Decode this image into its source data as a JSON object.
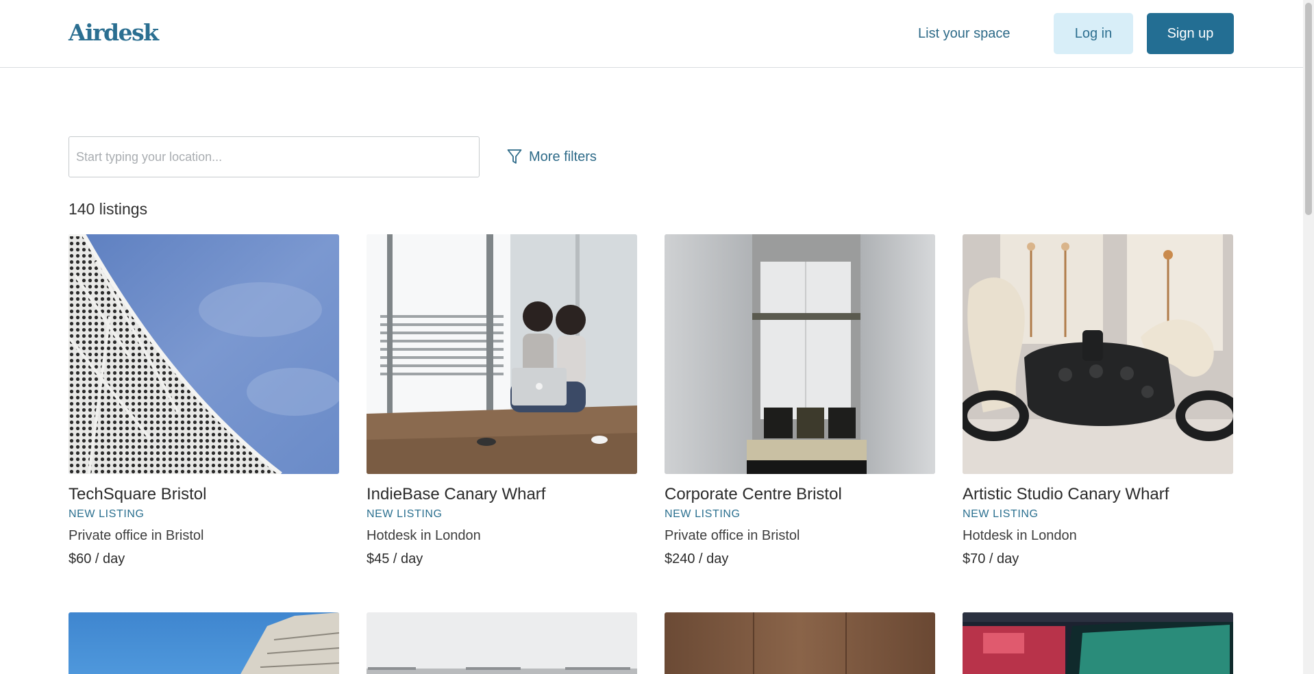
{
  "header": {
    "logo": "Airdesk",
    "list_space": "List your space",
    "login": "Log in",
    "signup": "Sign up"
  },
  "search": {
    "placeholder": "Start typing your location...",
    "value": ""
  },
  "filters": {
    "label": "More filters",
    "icon": "filter-icon"
  },
  "listing_count": "140 listings",
  "listings": [
    {
      "title": "TechSquare Bristol",
      "badge": "NEW LISTING",
      "type": "Private office in Bristol",
      "price": "$60 / day",
      "image": "perforated-facade-photo"
    },
    {
      "title": "IndieBase Canary Wharf",
      "badge": "NEW LISTING",
      "type": "Hotdesk in London",
      "price": "$45 / day",
      "image": "two-women-laptop-photo"
    },
    {
      "title": "Corporate Centre Bristol",
      "badge": "NEW LISTING",
      "type": "Private office in Bristol",
      "price": "$240 / day",
      "image": "elevator-lobby-photo"
    },
    {
      "title": "Artistic Studio Canary Wharf",
      "badge": "NEW LISTING",
      "type": "Hotdesk in London",
      "price": "$70 / day",
      "image": "vr-headset-photo"
    }
  ],
  "colors": {
    "brand": "#2b6f91",
    "primary_button": "#236e93",
    "secondary_button": "#d8eef8",
    "link": "#2d6a88"
  }
}
